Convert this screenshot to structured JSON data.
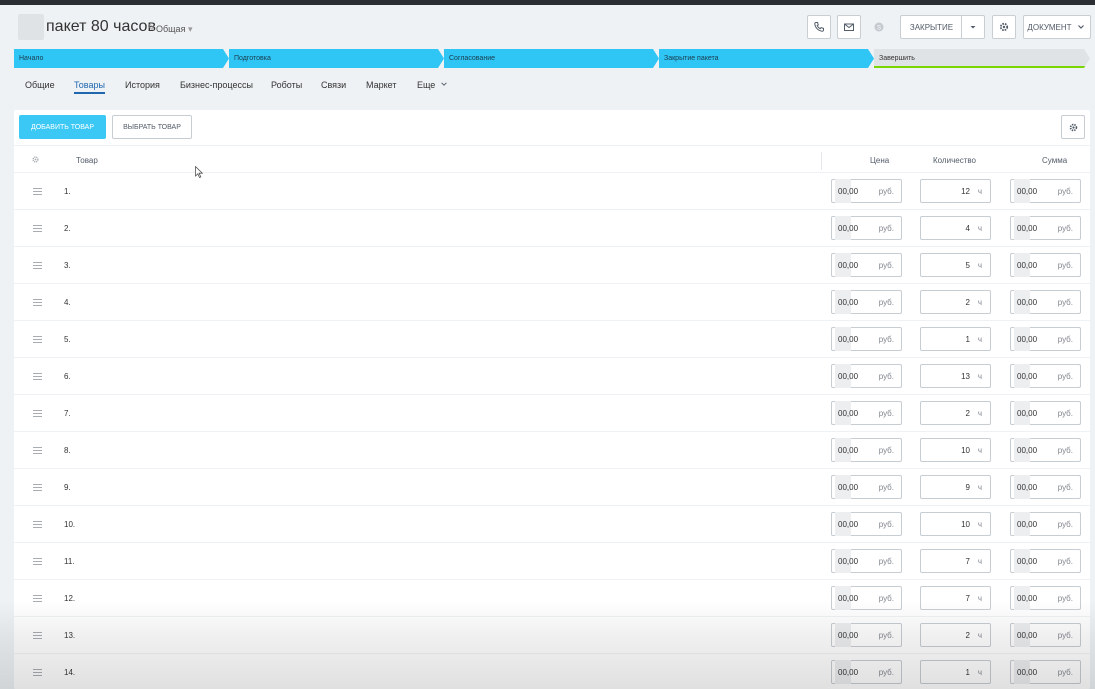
{
  "header": {
    "title": "пакет 80 часов",
    "category": "Общая",
    "category_arrow": "▾",
    "pencil": "✎",
    "closing_label": "ЗАКРЫТИЕ",
    "document_label": "ДОКУМЕНТ"
  },
  "stages": [
    "Начало",
    "Подготовка",
    "Согласование",
    "Закрытие пакета",
    "Завершить"
  ],
  "tabs": [
    "Общие",
    "Товары",
    "История",
    "Бизнес-процессы",
    "Роботы",
    "Связи",
    "Маркет",
    "Еще"
  ],
  "active_tab": "Товары",
  "toolbar": {
    "add_label": "ДОБАВИТЬ ТОВАР",
    "select_label": "ВЫБРАТЬ ТОВАР"
  },
  "table": {
    "columns": [
      "Товар",
      "Цена",
      "Количество",
      "Сумма"
    ],
    "price_value": "00,00",
    "currency": "руб.",
    "unit": "ч",
    "rows": [
      {
        "num": "1.",
        "qty": "12"
      },
      {
        "num": "2.",
        "qty": "4"
      },
      {
        "num": "3.",
        "qty": "5"
      },
      {
        "num": "4.",
        "qty": "2"
      },
      {
        "num": "5.",
        "qty": "1"
      },
      {
        "num": "6.",
        "qty": "13"
      },
      {
        "num": "7.",
        "qty": "2"
      },
      {
        "num": "8.",
        "qty": "10"
      },
      {
        "num": "9.",
        "qty": "9"
      },
      {
        "num": "10.",
        "qty": "10"
      },
      {
        "num": "11.",
        "qty": "7"
      },
      {
        "num": "12.",
        "qty": "7"
      },
      {
        "num": "13.",
        "qty": "2"
      },
      {
        "num": "14.",
        "qty": "1"
      }
    ]
  },
  "colors": {
    "stage_active": "#2fc6f6",
    "accent_tab": "#2067b0",
    "add_button": "#3bc8f5",
    "finish_underline": "#7bd500"
  }
}
